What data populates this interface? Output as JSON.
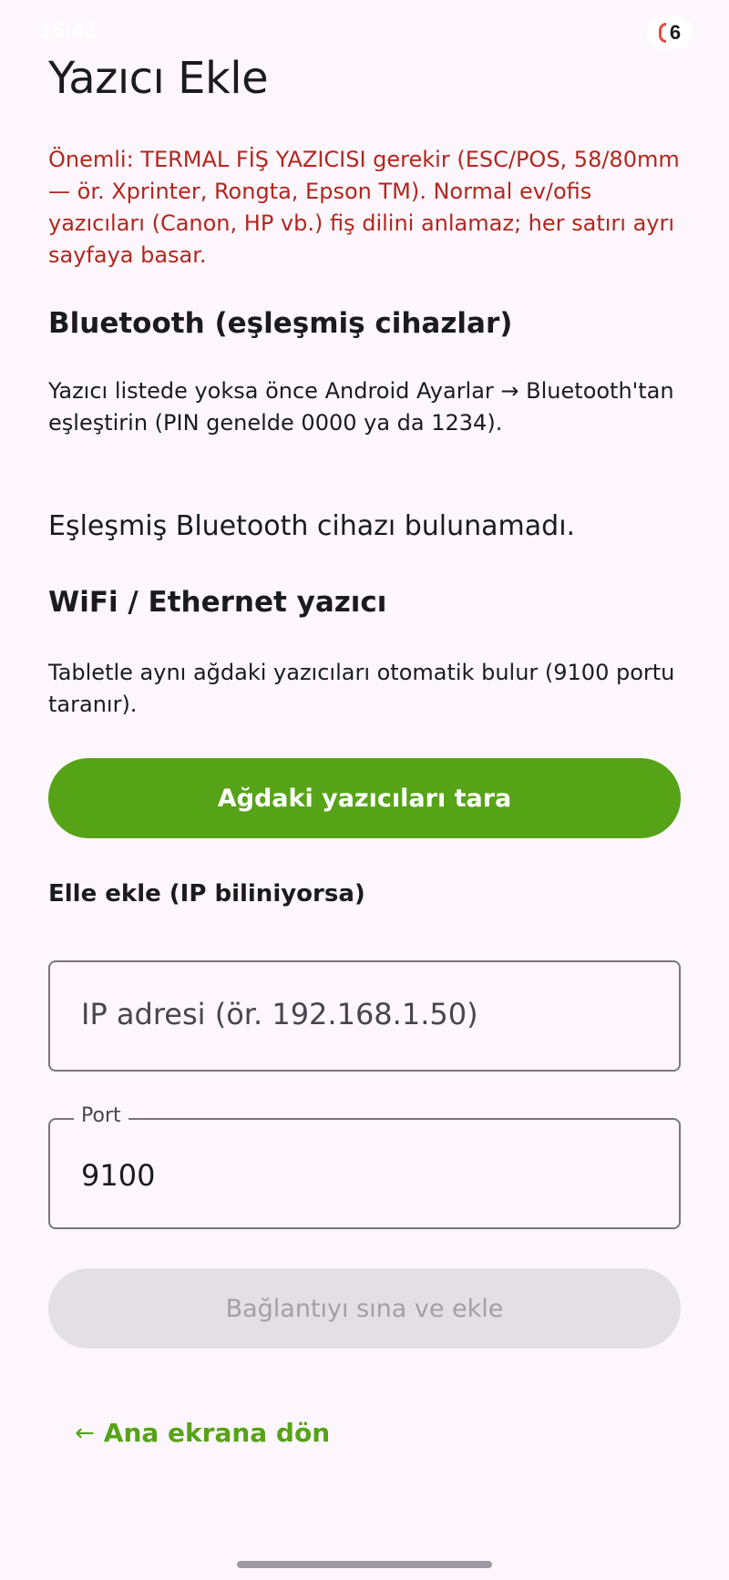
{
  "status_bar": {
    "time": "16:42",
    "badge_count": "6",
    "accent_color": "#e84a3c"
  },
  "page": {
    "title": "Yazıcı Ekle",
    "warning": "Önemli: TERMAL FİŞ YAZICISI gerekir (ESC/POS, 58/80mm — ör. Xprinter, Rongta, Epson TM). Normal ev/ofis yazıcıları (Canon, HP vb.) fiş dilini anlamaz; her satırı ayrı sayfaya basar."
  },
  "bluetooth": {
    "heading": "Bluetooth (eşleşmiş cihazlar)",
    "help": "Yazıcı listede yoksa önce Android Ayarlar → Bluetooth'tan eşleştirin (PIN genelde 0000 ya da 1234).",
    "empty_message": "Eşleşmiş Bluetooth cihazı bulunamadı."
  },
  "wifi": {
    "heading": "WiFi / Ethernet yazıcı",
    "help": "Tabletle aynı ağdaki yazıcıları otomatik bulur (9100 portu taranır).",
    "scan_button": "Ağdaki yazıcıları tara"
  },
  "manual": {
    "heading": "Elle ekle (IP biliniyorsa)",
    "ip_placeholder": "IP adresi (ör. 192.168.1.50)",
    "port_label": "Port",
    "port_value": "9100",
    "test_button": "Bağlantıyı sına ve ekle"
  },
  "footer": {
    "back_label": "Ana ekrana dön",
    "back_icon": "arrow-left-icon"
  },
  "colors": {
    "primary": "#57a317",
    "error": "#b3261e",
    "background": "#fdf7fd",
    "disabled_button": "#e3e0e5"
  }
}
